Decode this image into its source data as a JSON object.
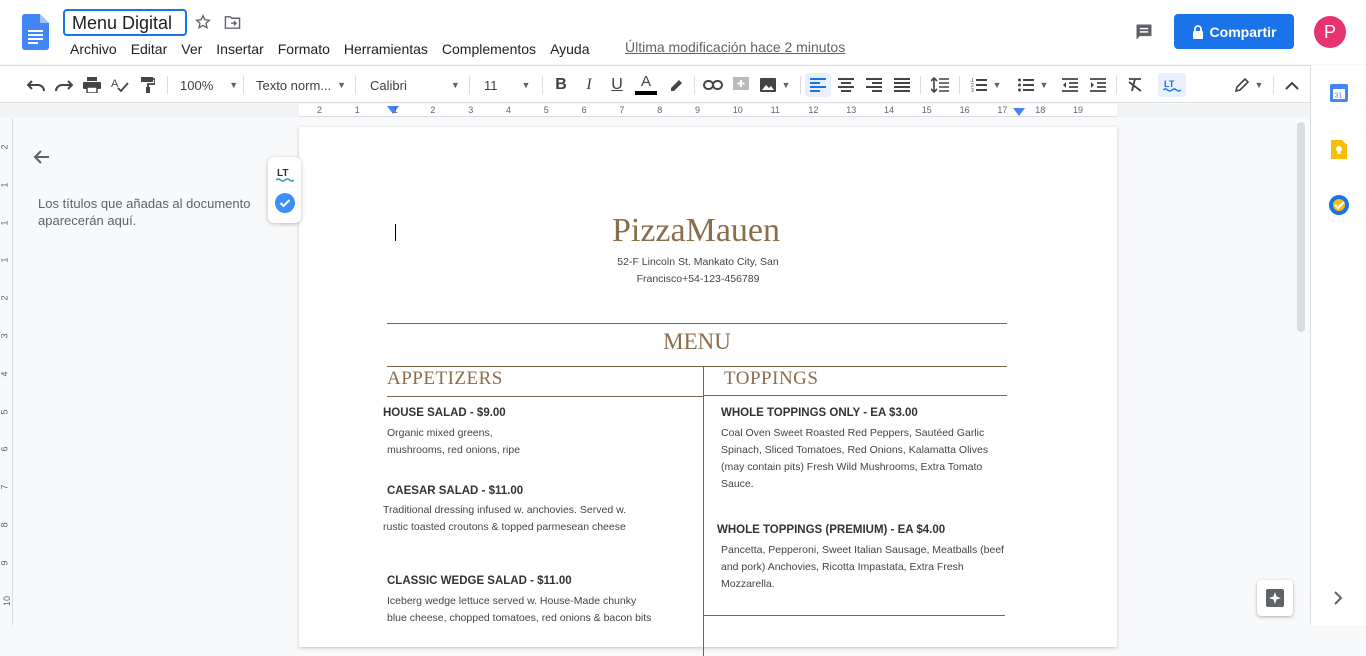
{
  "app": {
    "doc_title": "Menu Digital",
    "last_modified": "Última modificación hace 2 minutos",
    "share_label": "Compartir",
    "avatar_letter": "P"
  },
  "menu": [
    "Archivo",
    "Editar",
    "Ver",
    "Insertar",
    "Formato",
    "Herramientas",
    "Complementos",
    "Ayuda"
  ],
  "toolbar": {
    "zoom": "100%",
    "style": "Texto norm...",
    "font": "Calibri",
    "size": "11"
  },
  "ruler_numbers": [
    "2",
    "1",
    "1",
    "2",
    "3",
    "4",
    "5",
    "6",
    "7",
    "8",
    "9",
    "10",
    "11",
    "12",
    "13",
    "14",
    "15",
    "16",
    "17",
    "18",
    "19"
  ],
  "vruler_numbers": [
    "2",
    "1",
    "1",
    "1",
    "2",
    "3",
    "4",
    "5",
    "6",
    "7",
    "8",
    "9",
    "10"
  ],
  "outline": {
    "text": "Los títulos que añadas al documento aparecerán aquí."
  },
  "document": {
    "title": "PizzaMauen",
    "address_line1": "52-F Lincoln St. Mankato City, San",
    "address_line2": "Francisco+54-123-456789",
    "menu_heading": "MENU",
    "left_section": "APPETIZERS",
    "right_section": "TOPPINGS",
    "left_items": [
      {
        "title": "HOUSE SALAD - $9.00",
        "desc": [
          "Organic mixed greens,",
          "mushrooms, red onions, ripe"
        ]
      },
      {
        "title": "CAESAR SALAD - $11.00",
        "desc": [
          "Traditional dressing infused w. anchovies. Served w.",
          "rustic toasted croutons & topped parmesean cheese"
        ]
      },
      {
        "title": "CLASSIC WEDGE SALAD - $11.00",
        "desc": [
          "Iceberg wedge lettuce served w. House-Made chunky",
          "blue cheese, chopped tomatoes, red onions & bacon bits"
        ]
      }
    ],
    "right_items": [
      {
        "title": "WHOLE TOPPINGS ONLY - EA $3.00",
        "desc": [
          "Coal Oven Sweet Roasted Red Peppers, Sautéed Garlic",
          "Spinach, Sliced Tomatoes, Red Onions, Kalamatta Olives",
          "(may contain pits) Fresh Wild Mushrooms, Extra Tomato",
          "Sauce."
        ]
      },
      {
        "title": "WHOLE TOPPINGS  (PREMIUM) - EA $4.00",
        "desc": [
          "Pancetta, Pepperoni, Sweet Italian Sausage, Meatballs (beef",
          "and pork) Anchovies, Ricotta Impastata, Extra Fresh",
          "Mozzarella."
        ]
      }
    ]
  },
  "colors": {
    "accent": "#1a73e8",
    "brand_text": "#8a6d4b",
    "avatar": "#e8336e"
  }
}
